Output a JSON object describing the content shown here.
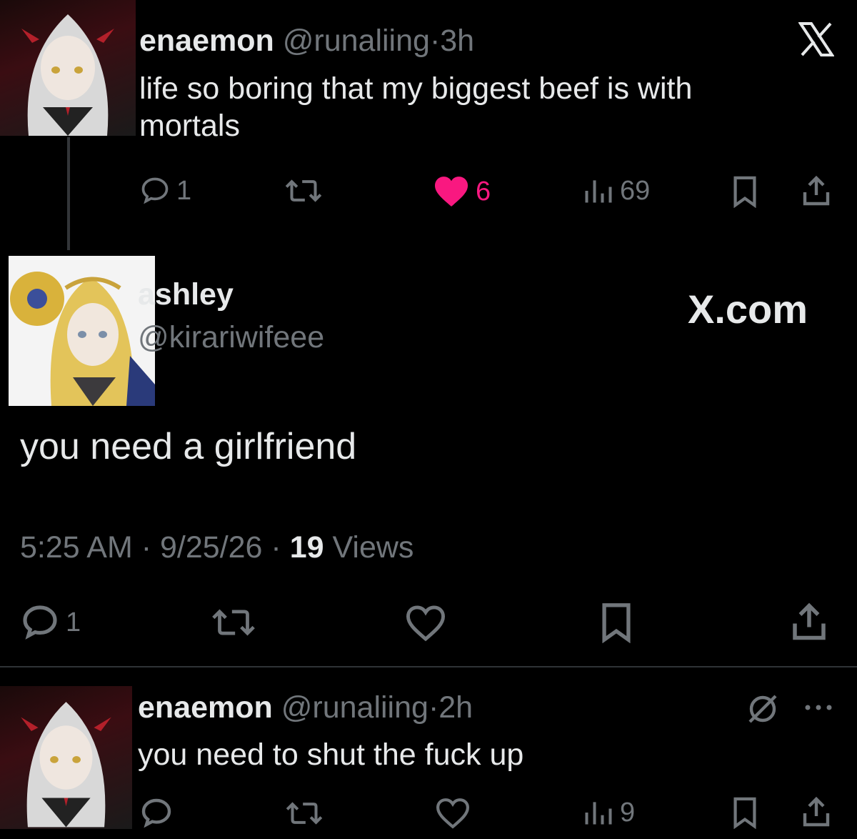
{
  "top_tweet": {
    "display_name": "enaemon",
    "handle": "@runaliing",
    "separator": "·",
    "time": "3h",
    "text_line1": "life so boring that my biggest beef is with",
    "text_line2": "mortals",
    "replies": "1",
    "likes": "6",
    "views": "69",
    "liked": true
  },
  "main_tweet": {
    "display_name": "ashley",
    "handle": "@kirariwifeee",
    "text": "you need a girlfriend",
    "time": "5:25 AM",
    "sep1": "·",
    "date": "9/25/26",
    "sep2": "·",
    "views_count": "19",
    "views_label": "Views",
    "replies": "1"
  },
  "reply_tweet": {
    "display_name": "enaemon",
    "handle": "@runaliing",
    "separator": "·",
    "time": "2h",
    "text": "you need to shut the fuck up",
    "views": "9"
  },
  "watermark": "X.com",
  "colors": {
    "background": "#000000",
    "text": "#e7e9ea",
    "muted": "#71767b",
    "like_pink": "#f91880",
    "divider": "#2f3336"
  },
  "icons": {
    "top_right": "x-logo-icon",
    "reply_menu": "more-icon",
    "reply_grok": "grok-icon"
  }
}
